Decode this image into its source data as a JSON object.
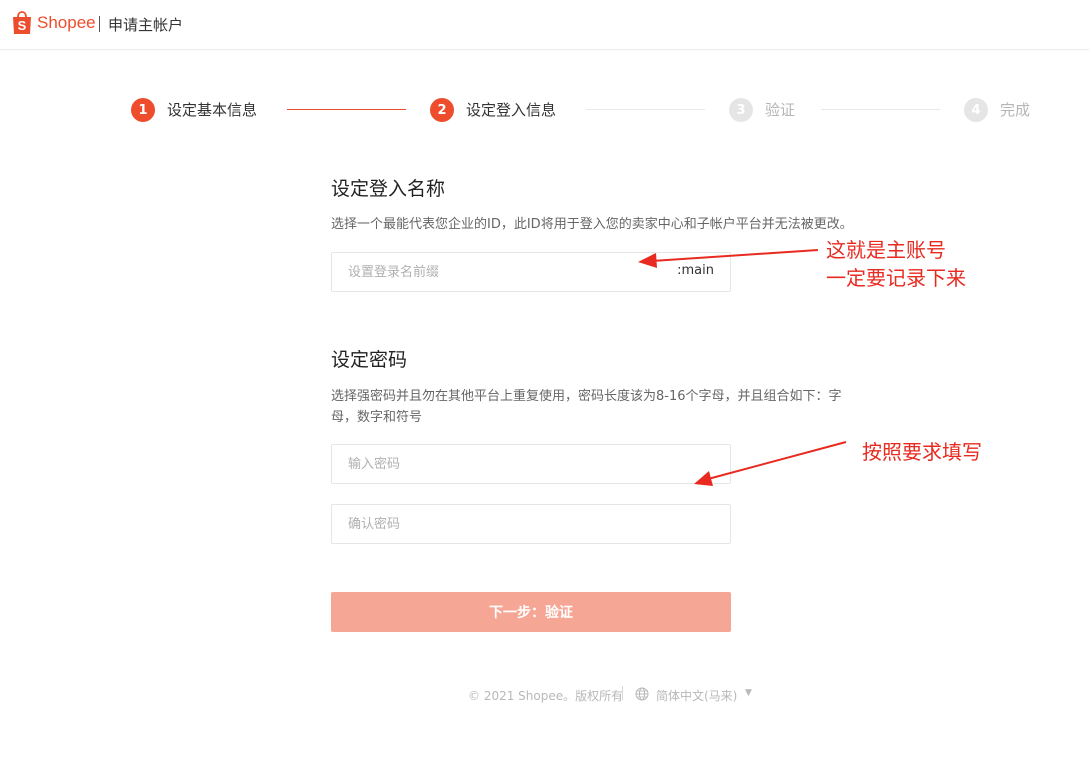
{
  "header": {
    "logo_text": "Shopee",
    "title": "申请主帐户"
  },
  "steps": [
    {
      "number": "1",
      "label": "设定基本信息",
      "state": "done"
    },
    {
      "number": "2",
      "label": "设定登入信息",
      "state": "current"
    },
    {
      "number": "3",
      "label": "验证",
      "state": "pending"
    },
    {
      "number": "4",
      "label": "完成",
      "state": "pending"
    }
  ],
  "login_section": {
    "title": "设定登入名称",
    "description": "选择一个最能代表您企业的ID，此ID将用于登入您的卖家中心和子帐户平台并无法被更改。",
    "input_placeholder": "设置登录名前缀",
    "input_value": "",
    "suffix": ":main"
  },
  "password_section": {
    "title": "设定密码",
    "description_line1": "选择强密码并且勿在其他平台上重复使用，密码长度该为8-16个字母，并且组合如下：字",
    "description_line2": "母，数字和符号",
    "password_placeholder": "输入密码",
    "confirm_placeholder": "确认密码"
  },
  "next_button": {
    "label": "下一步：验证"
  },
  "footer": {
    "copyright": "© 2021 Shopee。版权所有",
    "language": "简体中文(马来)",
    "language_caret": "▼"
  },
  "annotations": {
    "account_line1": "这就是主账号",
    "account_line2": "一定要记录下来",
    "password_note": "按照要求填写"
  },
  "colors": {
    "brand": "#ee4d2d",
    "button_disabled": "#f6a695",
    "annotation": "#e82a20"
  }
}
